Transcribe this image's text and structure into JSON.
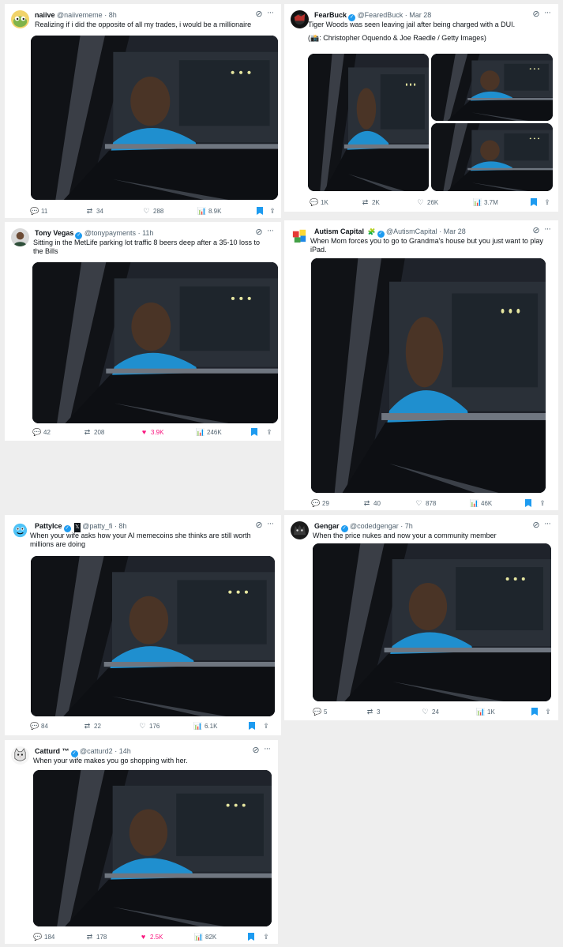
{
  "tweets": [
    {
      "name": "naiive",
      "handle": "@naiivememe",
      "dot": "·",
      "time": "8h",
      "text": "Realizing if i did the opposite of all my trades, i would be a millionaire",
      "avatar_icon": "pepe-avatar-icon",
      "stats": {
        "replies": "11",
        "reposts": "34",
        "likes": "288",
        "views": "8.9K"
      },
      "liked": false
    },
    {
      "name": "FearBuck",
      "handle": "@FearedBuck",
      "dot": "·",
      "time": "Mar 28",
      "text": "Tiger Woods was seen leaving jail after being charged with a DUI.",
      "text_line2": "(📸: Christopher Oquendo & Joe Raedle / Getty Images)",
      "avatar_icon": "fearbuck-avatar-icon",
      "stats": {
        "replies": "1K",
        "reposts": "2K",
        "likes": "26K",
        "views": "3.7M"
      },
      "liked": false
    },
    {
      "name": "Tony Vegas",
      "handle": "@tonypayments",
      "dot": "·",
      "time": "11h",
      "text": "Sitting in the MetLife parking lot traffic 8 beers deep after a 35-10 loss to the Bills",
      "avatar_icon": "portrait-avatar-icon",
      "stats": {
        "replies": "42",
        "reposts": "208",
        "likes": "3.9K",
        "views": "246K"
      },
      "liked": true
    },
    {
      "name": "Autism Capital",
      "flair": "🧩",
      "handle": "@AutismCapital",
      "dot": "·",
      "time": "Mar 28",
      "text": "When Mom forces you to go to Grandma's house but you just want to play iPad.",
      "avatar_icon": "puzzle-avatar-icon",
      "stats": {
        "replies": "29",
        "reposts": "40",
        "likes": "878",
        "views": "46K"
      },
      "liked": false
    },
    {
      "name": "PattyIce",
      "flair": "𝕏",
      "handle": "@patty_fi",
      "dot": "·",
      "time": "8h",
      "text": "When your wife asks how your AI memecoins she thinks are still worth millions are doing",
      "avatar_icon": "cartoon-avatar-icon",
      "stats": {
        "replies": "84",
        "reposts": "22",
        "likes": "176",
        "views": "6.1K"
      },
      "liked": false
    },
    {
      "name": "Gengar",
      "handle": "@codedgengar",
      "dot": "·",
      "time": "7h",
      "text": "When the price nukes and now your a community member",
      "avatar_icon": "gengar-avatar-icon",
      "stats": {
        "replies": "5",
        "reposts": "3",
        "likes": "24",
        "views": "1K"
      },
      "liked": false
    },
    {
      "name": "Catturd ™",
      "handle": "@catturd2",
      "dot": "·",
      "time": "14h",
      "text": "When your wife makes you go shopping with her.",
      "avatar_icon": "cat-avatar-icon",
      "stats": {
        "replies": "184",
        "reposts": "178",
        "likes": "2.5K",
        "views": "82K"
      },
      "liked": true
    }
  ],
  "icons": {
    "reply": "💬",
    "repost": "⇄",
    "like": "♡",
    "liked": "♥",
    "views": "📊",
    "share": "⇪",
    "grok": "⊘",
    "more": "···"
  },
  "colors": {
    "accent": "#1d9bf0",
    "like": "#f91880",
    "muted": "#536471",
    "shirt": "#1f8fcf"
  }
}
